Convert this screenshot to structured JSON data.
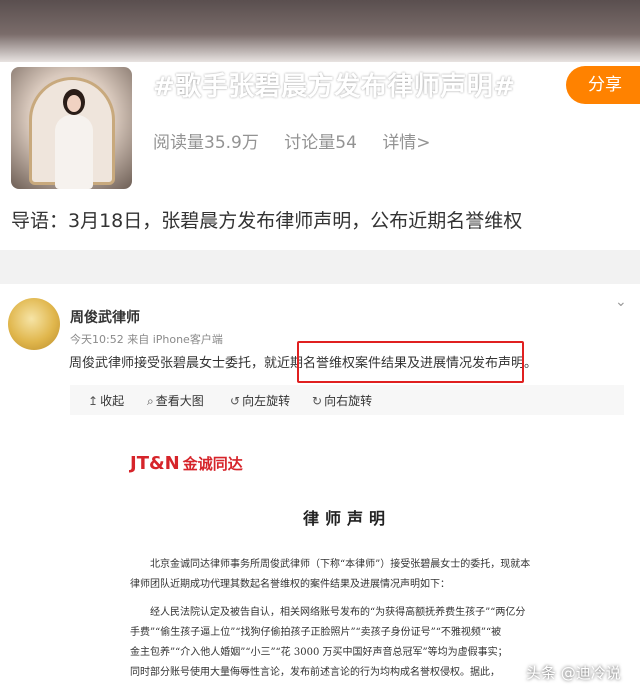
{
  "topic": {
    "title": "#歌手张碧晨方发布律师声明#",
    "share_label": "分享",
    "read_count": "阅读量35.9万",
    "discuss_count": "讨论量54",
    "details_link": "详情>",
    "guide_text": "导语：3月18日，张碧晨方发布律师声明，公布近期名誉维权"
  },
  "post": {
    "author": "周俊武律师",
    "meta": "今天10:52  来自 iPhone客户端",
    "text": "周俊武律师接受张碧晨女士委托，就近期名誉维权案件结果及进展情况发布声明。"
  },
  "viewer": {
    "tools": [
      {
        "icon": "↥",
        "label": "收起"
      },
      {
        "icon": "⌕",
        "label": "查看大图"
      },
      {
        "icon": "↺",
        "label": "向左旋转"
      },
      {
        "icon": "↻",
        "label": "向右旋转"
      }
    ]
  },
  "document": {
    "logo_text": "JT&N",
    "logo_cn": "金诚同达",
    "title": "律师声明",
    "lines": [
      "北京金诚同达律师事务所周俊武律师（下称“本律师”）接受张碧晨女士的委托，现就本",
      "律师团队近期成功代理其数起名誉维权的案件结果及进展情况声明如下：",
      "经人民法院认定及被告自认，相关网络账号发布的“为获得高额抚养费生孩子”“两亿分",
      "手费”“偷生孩子逼上位”“找狗仔偷拍孩子正脸照片”“卖孩子身份证号”“不雅视频”“被",
      "金主包养”“介入他人婚姻”“小三”“花 3000 万买中国好声音总冠军”等均为虚假事实；",
      "同时部分账号使用大量侮辱性言论，发布前述言论的行为均构成名誉权侵权。据此，"
    ]
  },
  "watermark": "头条 @迪冷说"
}
